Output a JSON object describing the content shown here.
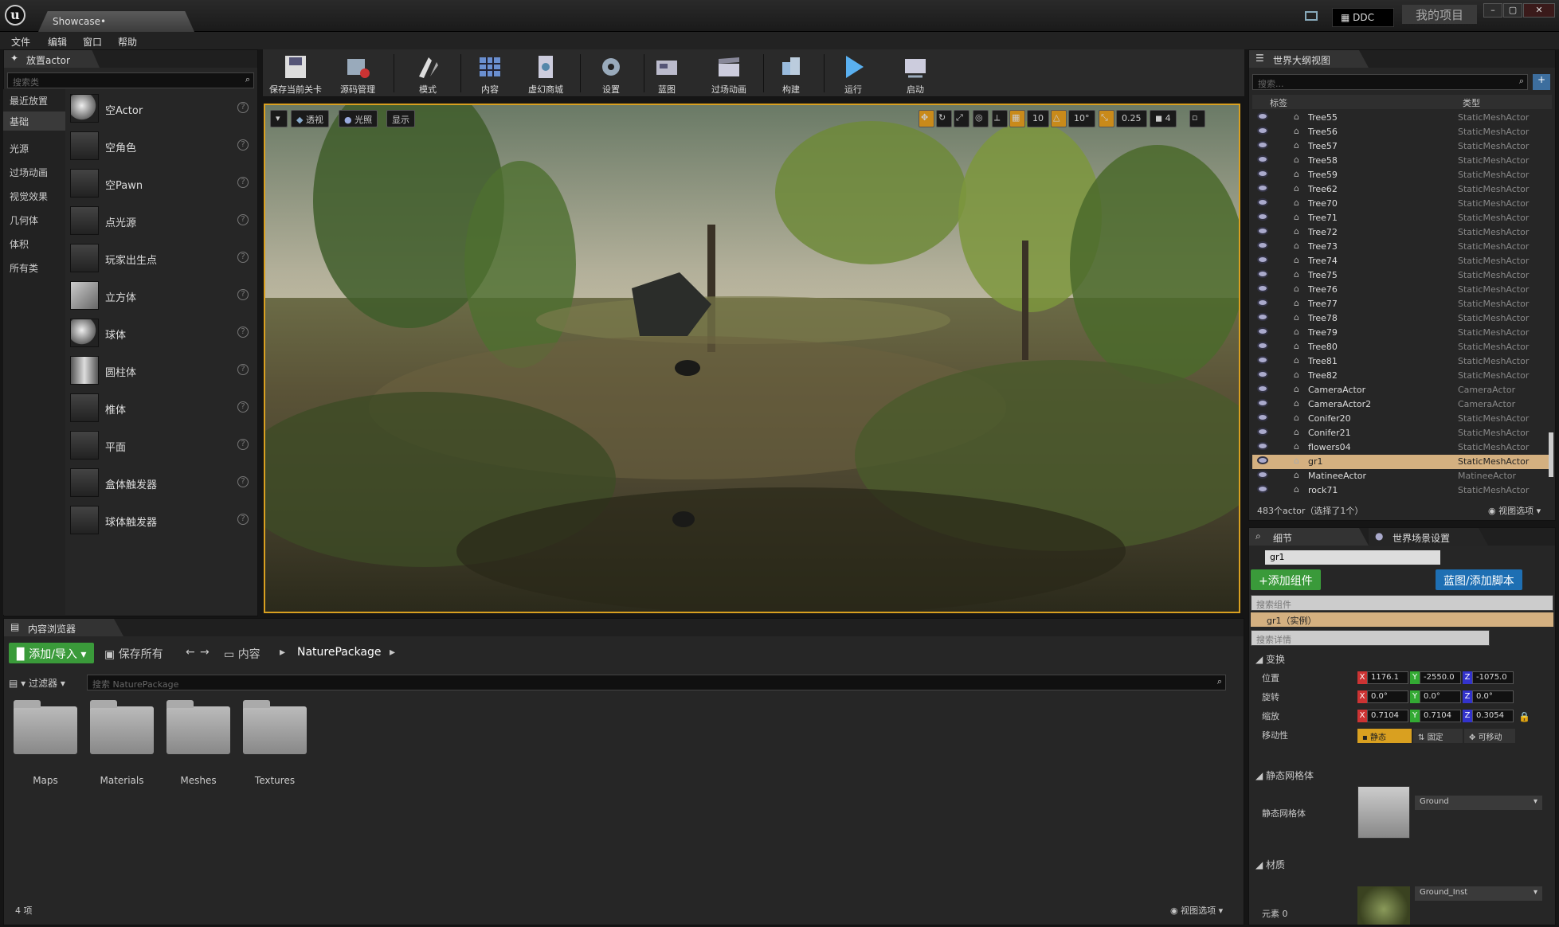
{
  "titlebar": {
    "project_tab": "Showcase•",
    "ddc": "DDC",
    "my_project": "我的项目",
    "min": "–",
    "max": "▢",
    "close": "✕"
  },
  "menu": [
    "文件",
    "编辑",
    "窗口",
    "帮助"
  ],
  "place_actors": {
    "tab": "放置actor",
    "search_placeholder": "搜索类",
    "categories": [
      "最近放置",
      "基础",
      "光源",
      "过场动画",
      "视觉效果",
      "几何体",
      "体积",
      "所有类"
    ],
    "selected_category": "基础",
    "items": [
      "空Actor",
      "空角色",
      "空Pawn",
      "点光源",
      "玩家出生点",
      "立方体",
      "球体",
      "圆柱体",
      "椎体",
      "平面",
      "盒体触发器",
      "球体触发器"
    ]
  },
  "toolbar": [
    "保存当前关卡",
    "源码管理",
    "模式",
    "内容",
    "虚幻商城",
    "设置",
    "蓝图",
    "过场动画",
    "构建",
    "运行",
    "启动"
  ],
  "viewport": {
    "perspective": "透视",
    "lighting": "光照",
    "show": "显示",
    "grid_snap": "10",
    "rot_snap": "10°",
    "scale_snap": "0.25",
    "cam_speed": "4"
  },
  "outliner": {
    "tab": "世界大纲视图",
    "search_placeholder": "搜索...",
    "col_label": "标签",
    "col_type": "类型",
    "rows": [
      {
        "name": "Tree55",
        "type": "StaticMeshActor"
      },
      {
        "name": "Tree56",
        "type": "StaticMeshActor"
      },
      {
        "name": "Tree57",
        "type": "StaticMeshActor"
      },
      {
        "name": "Tree58",
        "type": "StaticMeshActor"
      },
      {
        "name": "Tree59",
        "type": "StaticMeshActor"
      },
      {
        "name": "Tree62",
        "type": "StaticMeshActor"
      },
      {
        "name": "Tree70",
        "type": "StaticMeshActor"
      },
      {
        "name": "Tree71",
        "type": "StaticMeshActor"
      },
      {
        "name": "Tree72",
        "type": "StaticMeshActor"
      },
      {
        "name": "Tree73",
        "type": "StaticMeshActor"
      },
      {
        "name": "Tree74",
        "type": "StaticMeshActor"
      },
      {
        "name": "Tree75",
        "type": "StaticMeshActor"
      },
      {
        "name": "Tree76",
        "type": "StaticMeshActor"
      },
      {
        "name": "Tree77",
        "type": "StaticMeshActor"
      },
      {
        "name": "Tree78",
        "type": "StaticMeshActor"
      },
      {
        "name": "Tree79",
        "type": "StaticMeshActor"
      },
      {
        "name": "Tree80",
        "type": "StaticMeshActor"
      },
      {
        "name": "Tree81",
        "type": "StaticMeshActor"
      },
      {
        "name": "Tree82",
        "type": "StaticMeshActor"
      },
      {
        "name": "CameraActor",
        "type": "CameraActor"
      },
      {
        "name": "CameraActor2",
        "type": "CameraActor"
      },
      {
        "name": "Conifer20",
        "type": "StaticMeshActor"
      },
      {
        "name": "Conifer21",
        "type": "StaticMeshActor"
      },
      {
        "name": "flowers04",
        "type": "StaticMeshActor"
      },
      {
        "name": "gr1",
        "type": "StaticMeshActor"
      },
      {
        "name": "MatineeActor",
        "type": "MatineeActor"
      },
      {
        "name": "rock71",
        "type": "StaticMeshActor"
      }
    ],
    "selected": "gr1",
    "footer": "483个actor（选择了1个）",
    "view_options": "视图选项"
  },
  "details": {
    "tab_details": "细节",
    "tab_world": "世界场景设置",
    "name_value": "gr1",
    "add_component": "+添加组件",
    "blueprint": "蓝图/添加脚本",
    "search_components": "搜索组件",
    "instance": "gr1（实例）",
    "search_details": "搜索详情",
    "transform": "变换",
    "location": "位置",
    "rotation": "旋转",
    "scale": "缩放",
    "mobility": "移动性",
    "loc": [
      "1176.1",
      "-2550.0",
      "-1075.0"
    ],
    "rot": [
      "0.0°",
      "0.0°",
      "0.0°"
    ],
    "scl": [
      "0.7104",
      "0.7104",
      "0.3054"
    ],
    "mob_static": "静态",
    "mob_stationary": "固定",
    "mob_movable": "可移动",
    "static_mesh_section": "静态网格体",
    "static_mesh_label": "静态网格体",
    "mesh_name": "Ground",
    "materials_section": "材质",
    "element0": "元素 0",
    "material_name": "Ground_Inst",
    "x": "X",
    "y": "Y",
    "z": "Z"
  },
  "content_browser": {
    "tab": "内容浏览器",
    "add_import": "添加/导入",
    "save_all": "保存所有",
    "path_root": "内容",
    "path_folder": "NaturePackage",
    "filters": "过滤器",
    "search_placeholder": "搜索 NaturePackage",
    "folders": [
      "Maps",
      "Materials",
      "Meshes",
      "Textures"
    ],
    "count": "4 项",
    "view_options": "视图选项"
  }
}
